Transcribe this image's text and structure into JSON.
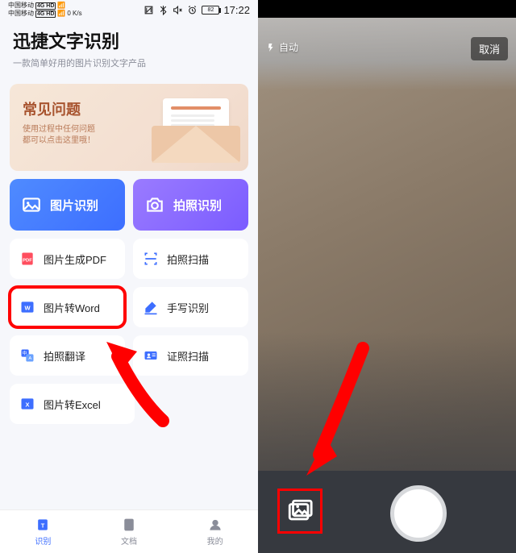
{
  "left": {
    "status": {
      "carrier1": "中国移动",
      "carrier2": "中国移动",
      "net1": "4G HD",
      "net2": "4G HD",
      "speed": "0 K/s",
      "battery": "82",
      "time": "17:22"
    },
    "title": "迅捷文字识别",
    "subtitle": "一款简单好用的图片识别文字产品",
    "faq": {
      "title": "常见问题",
      "line1": "使用过程中任何问题",
      "line2": "都可以点击这里哦！"
    },
    "primary": {
      "image_ocr": "图片识别",
      "photo_ocr": "拍照识别"
    },
    "grid": {
      "pdf": "图片生成PDF",
      "scan": "拍照扫描",
      "word": "图片转Word",
      "handwrite": "手写识别",
      "translate": "拍照翻译",
      "idcard": "证照扫描",
      "excel": "图片转Excel"
    },
    "nav": {
      "ocr": "识别",
      "docs": "文档",
      "me": "我的"
    }
  },
  "right": {
    "flash": "自动",
    "cancel": "取消"
  },
  "colors": {
    "accent_blue": "#3d6eff",
    "accent_purple": "#7b5cff",
    "highlight_red": "#ff0000"
  }
}
